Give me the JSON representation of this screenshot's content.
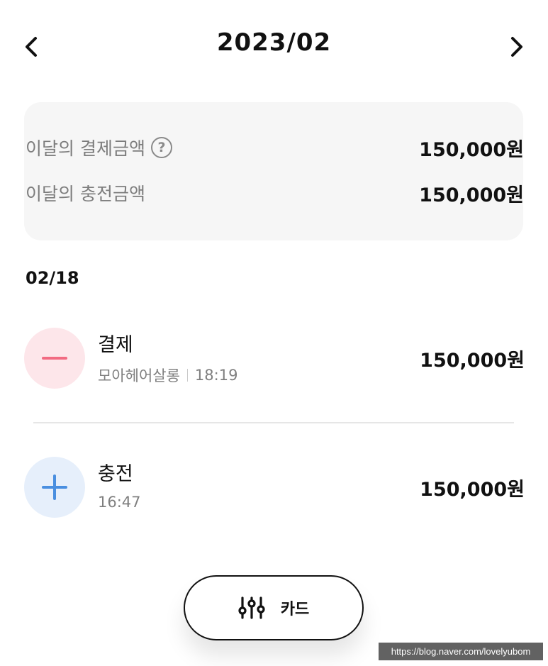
{
  "header": {
    "title": "2023/02",
    "prev_icon": "chevron-left-icon",
    "next_icon": "chevron-right-icon"
  },
  "summary": {
    "payment_label": "이달의 결제금액",
    "payment_value": "150,000원",
    "help_icon": "question-circle-icon",
    "charge_label": "이달의 충전금액",
    "charge_value": "150,000원"
  },
  "transactions": {
    "date": "02/18",
    "items": [
      {
        "type_label": "결제",
        "merchant": "모아헤어살롱",
        "time": "18:19",
        "amount": "150,000원",
        "icon": "minus-icon",
        "icon_color": "#f26b82",
        "icon_bg": "#fde6ea"
      },
      {
        "type_label": "충전",
        "time": "16:47",
        "amount": "150,000원",
        "icon": "plus-icon",
        "icon_color": "#4a8fe0",
        "icon_bg": "#e6effb"
      }
    ]
  },
  "filter_button": {
    "label": "카드",
    "icon": "sliders-icon"
  },
  "watermark": "https://blog.naver.com/lovelyubom"
}
